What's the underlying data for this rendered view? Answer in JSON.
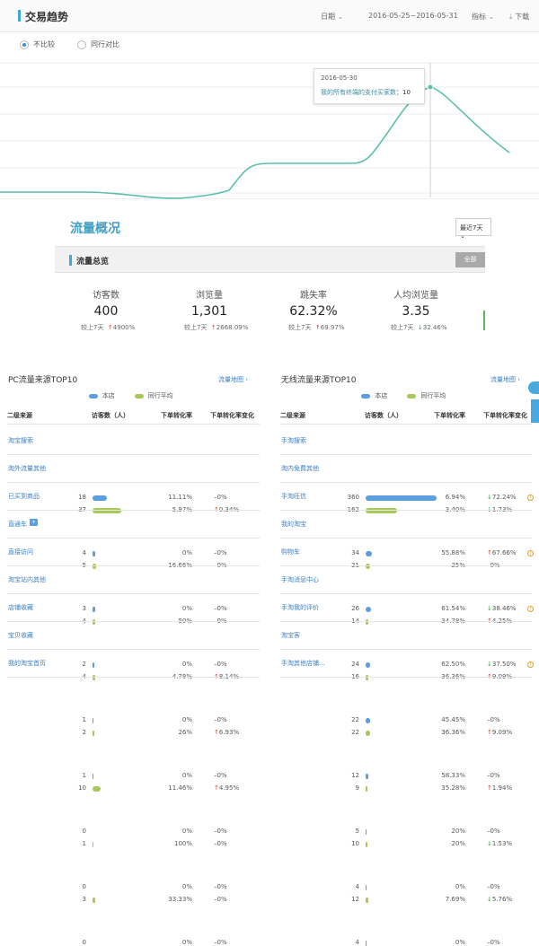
{
  "colors": {
    "accent": "#3fa9d5",
    "line": "#5bbfae",
    "store_bar": "#5b9fe0",
    "peer_bar": "#a8c95a",
    "link": "#3a7fc4",
    "up": "#e04a3a",
    "down": "#3aa04a"
  },
  "trend": {
    "title": "交易趋势",
    "period": "日期",
    "date_range": "2016-05-25~2016-05-31",
    "metric": "指标",
    "download": "下载",
    "radio_no_compare": "不比较",
    "radio_peer": "同行对比",
    "tooltip_date": "2016-05-30",
    "tooltip_label": "我的所有终端的支付买家数",
    "tooltip_value": "10"
  },
  "flow": {
    "title": "流量概况",
    "range": "最近7天",
    "section": "流量总览",
    "all_button": "全部",
    "metrics": [
      {
        "name": "访客数",
        "value": "400",
        "cmp": "较上7天",
        "chg": "4900%",
        "dir": "up"
      },
      {
        "name": "浏览量",
        "value": "1,301",
        "cmp": "较上7天",
        "chg": "2668.09%",
        "dir": "up"
      },
      {
        "name": "跳失率",
        "value": "62.32%",
        "cmp": "较上7天",
        "chg": "69.97%",
        "dir": "up"
      },
      {
        "name": "人均浏览量",
        "value": "3.35",
        "cmp": "较上7天",
        "chg": "32.46%",
        "dir": "down"
      }
    ]
  },
  "pc": {
    "title": "PC流量来源TOP10",
    "link": "流量地图 ›",
    "legend_store": "本店",
    "legend_peer": "同行平均",
    "headers": [
      "二级来源",
      "访客数（人）",
      "下单转化率",
      "下单转化率变化"
    ],
    "rows": [
      {
        "name": "淘宝搜索",
        "a": "18",
        "b": "37",
        "r1": "11.11%",
        "r2": "5.97%",
        "c1": "0%",
        "c2": "0.34%",
        "d1": "flat",
        "d2": "up",
        "wa": 0.06,
        "wb": 0.12
      },
      {
        "name": "淘外流量其他",
        "a": "4",
        "b": "5",
        "r1": "0%",
        "r2": "16.66%",
        "c1": "0%",
        "c2": "0%",
        "d1": "flat",
        "d2": "flat",
        "wa": 0.013,
        "wb": 0.016
      },
      {
        "name": "已买到商品",
        "a": "3",
        "b": "4",
        "r1": "0%",
        "r2": "50%",
        "c1": "0%",
        "c2": "0%",
        "d1": "flat",
        "d2": "flat",
        "wa": 0.01,
        "wb": 0.013
      },
      {
        "name": "直通车",
        "a": "2",
        "b": "4",
        "r1": "0%",
        "r2": "4.78%",
        "c1": "0%",
        "c2": "8.14%",
        "d1": "flat",
        "d2": "up",
        "wa": 0.007,
        "wb": 0.013
      },
      {
        "name": "直接访问",
        "a": "1",
        "b": "2",
        "r1": "0%",
        "r2": "26%",
        "c1": "0%",
        "c2": "6.93%",
        "d1": "flat",
        "d2": "up",
        "wa": 0.003,
        "wb": 0.007
      },
      {
        "name": "淘宝站内其他",
        "a": "1",
        "b": "10",
        "r1": "0%",
        "r2": "11.46%",
        "c1": "0%",
        "c2": "4.95%",
        "d1": "flat",
        "d2": "up",
        "wa": 0.003,
        "wb": 0.033
      },
      {
        "name": "店铺收藏",
        "a": "0",
        "b": "1",
        "r1": "0%",
        "r2": "100%",
        "c1": "0%",
        "c2": "0%",
        "d1": "flat",
        "d2": "flat",
        "wa": 0,
        "wb": 0.003
      },
      {
        "name": "宝贝收藏",
        "a": "0",
        "b": "3",
        "r1": "0%",
        "r2": "33.33%",
        "c1": "0%",
        "c2": "0%",
        "d1": "flat",
        "d2": "flat",
        "wa": 0,
        "wb": 0.01
      },
      {
        "name": "我的淘宝首页",
        "a": "0",
        "b": "",
        "r1": "0%",
        "r2": "",
        "c1": "0%",
        "c2": "",
        "d1": "flat",
        "d2": "flat",
        "wa": 0,
        "wb": 0
      }
    ]
  },
  "mobile": {
    "title": "无线流量来源TOP10",
    "link": "流量地图 ›",
    "legend_store": "本店",
    "legend_peer": "同行平均",
    "headers": [
      "二级来源",
      "访客数（人）",
      "下单转化率",
      "下单转化率变化"
    ],
    "rows": [
      {
        "name": "手淘搜索",
        "a": "360",
        "b": "162",
        "r1": "6.94%",
        "r2": "3.40%",
        "c1": "72.24%",
        "c2": "1.73%",
        "d1": "down",
        "d2": "down",
        "wa": 0.3,
        "wb": 0.135,
        "warn": true
      },
      {
        "name": "淘内免费其他",
        "a": "34",
        "b": "21",
        "r1": "55.88%",
        "r2": "25%",
        "c1": "67.66%",
        "c2": "0%",
        "d1": "up",
        "d2": "flat",
        "wa": 0.028,
        "wb": 0.018,
        "warn": true
      },
      {
        "name": "手淘旺信",
        "a": "26",
        "b": "14",
        "r1": "61.54%",
        "r2": "34.78%",
        "c1": "38.46%",
        "c2": "4.25%",
        "d1": "down",
        "d2": "up",
        "wa": 0.022,
        "wb": 0.012,
        "warn": true
      },
      {
        "name": "我的淘宝",
        "a": "24",
        "b": "16",
        "r1": "62.50%",
        "r2": "36.36%",
        "c1": "37.50%",
        "c2": "9.09%",
        "d1": "down",
        "d2": "up",
        "wa": 0.02,
        "wb": 0.013,
        "warn": true
      },
      {
        "name": "购物车",
        "a": "22",
        "b": "22",
        "r1": "45.45%",
        "r2": "36.36%",
        "c1": "0%",
        "c2": "9.09%",
        "d1": "flat",
        "d2": "up",
        "wa": 0.018,
        "wb": 0.018
      },
      {
        "name": "手淘消息中心",
        "a": "12",
        "b": "9",
        "r1": "58.33%",
        "r2": "35.28%",
        "c1": "0%",
        "c2": "1.94%",
        "d1": "flat",
        "d2": "up",
        "wa": 0.01,
        "wb": 0.008
      },
      {
        "name": "手淘我的评价",
        "a": "5",
        "b": "10",
        "r1": "20%",
        "r2": "20%",
        "c1": "0%",
        "c2": "1.53%",
        "d1": "flat",
        "d2": "down",
        "wa": 0.004,
        "wb": 0.008
      },
      {
        "name": "淘宝客",
        "a": "4",
        "b": "12",
        "r1": "0%",
        "r2": "7.69%",
        "c1": "0%",
        "c2": "5.76%",
        "d1": "flat",
        "d2": "down",
        "wa": 0.003,
        "wb": 0.01
      },
      {
        "name": "手淘其他店铺...",
        "a": "4",
        "b": "",
        "r1": "0%",
        "r2": "",
        "c1": "0%",
        "c2": "",
        "d1": "flat",
        "d2": "flat",
        "wa": 0.003,
        "wb": 0
      }
    ]
  }
}
